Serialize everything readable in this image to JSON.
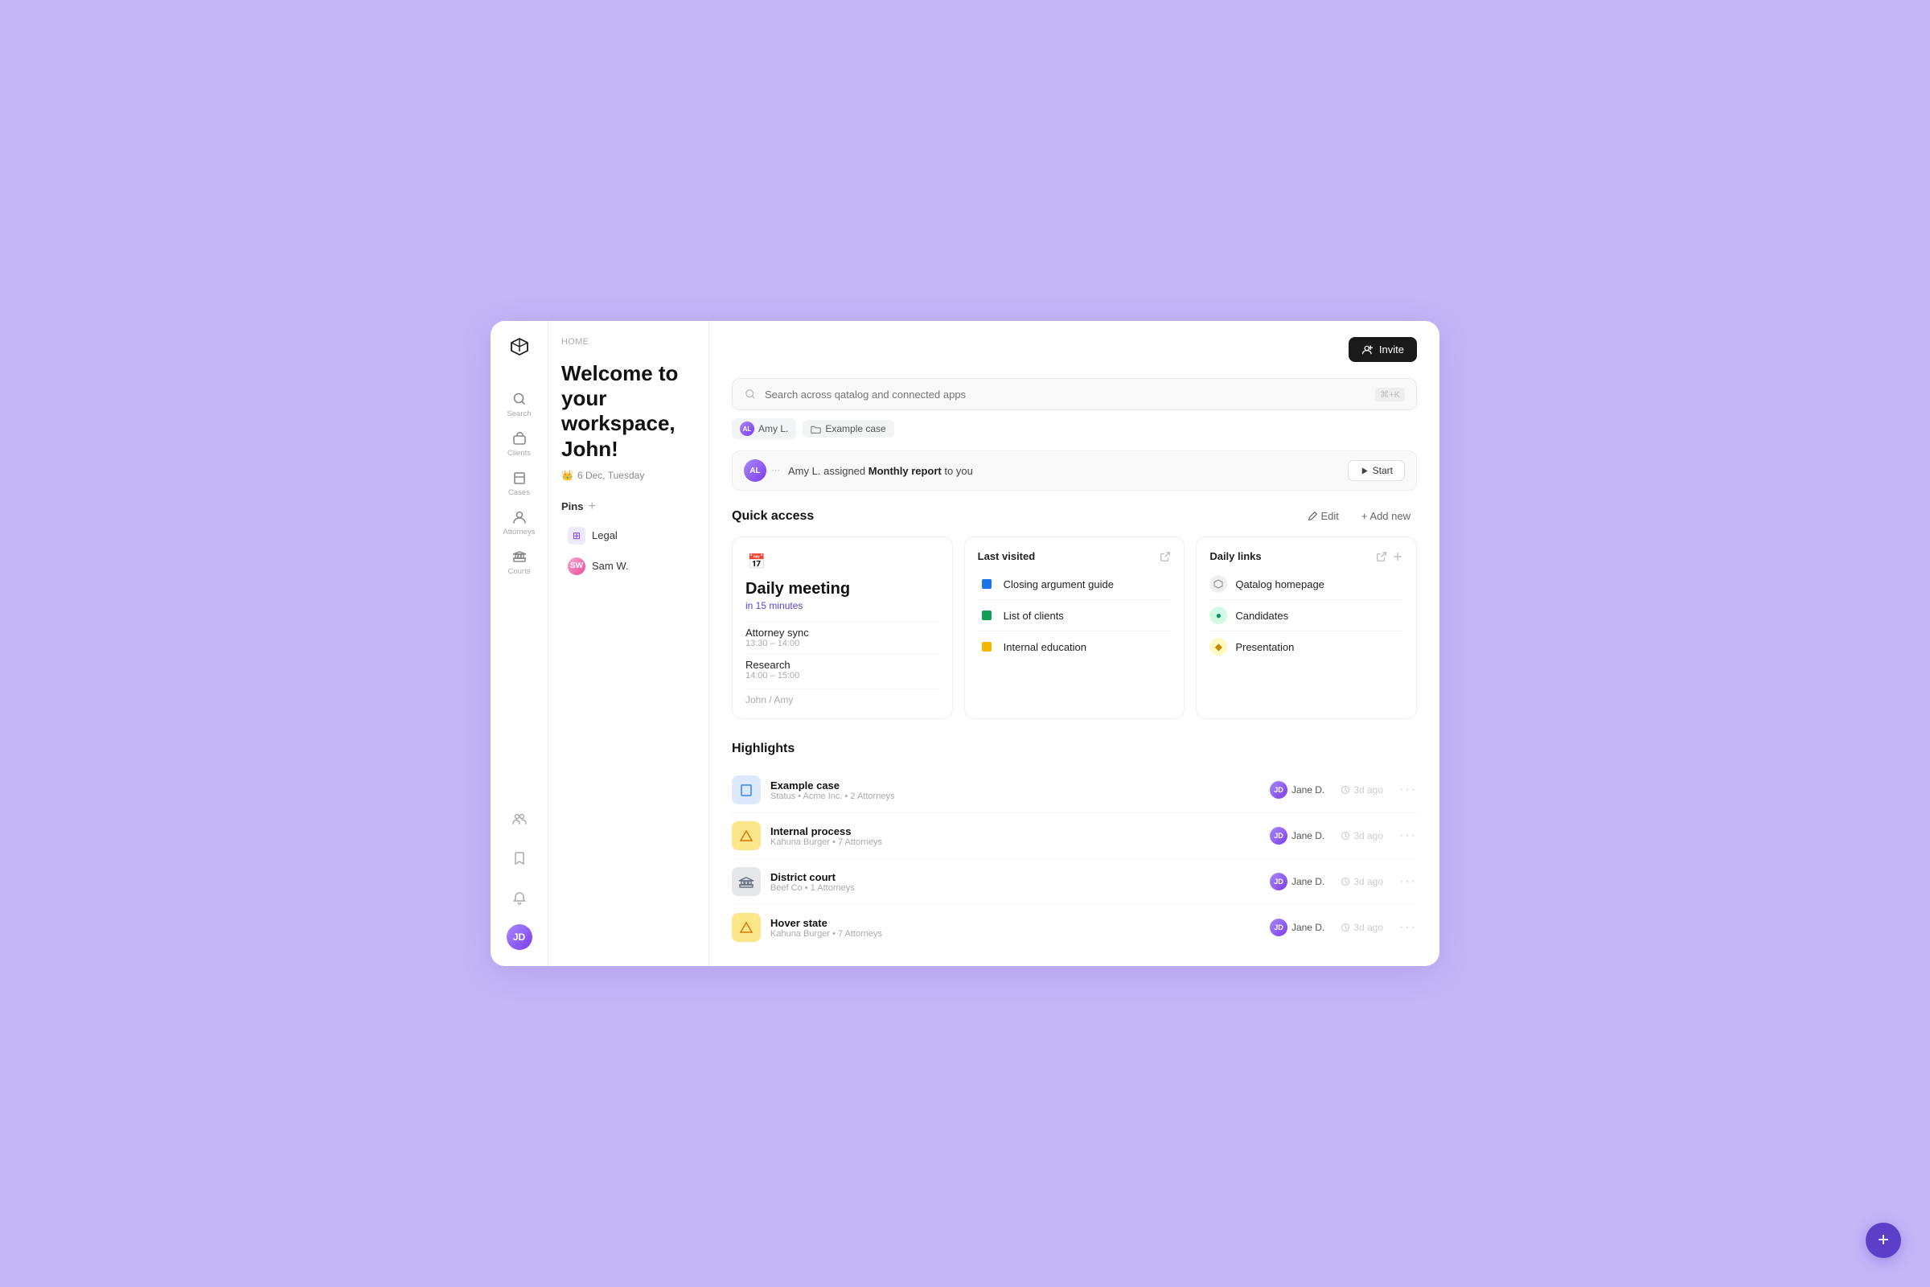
{
  "header": {
    "breadcrumb": "HOME",
    "invite_label": "Invite"
  },
  "welcome": {
    "title": "Welcome to your workspace, John!",
    "date": "6 Dec, Tuesday"
  },
  "sidebar": {
    "logo_alt": "Qatalog logo",
    "nav_items": [
      {
        "id": "search",
        "label": "Search",
        "icon": "search"
      },
      {
        "id": "clients",
        "label": "Clients",
        "icon": "briefcase"
      },
      {
        "id": "cases",
        "label": "Cases",
        "icon": "folder"
      },
      {
        "id": "attorneys",
        "label": "Attorneys",
        "icon": "person"
      },
      {
        "id": "courts",
        "label": "Courts",
        "icon": "building"
      }
    ],
    "bottom_icons": [
      {
        "id": "team",
        "icon": "team"
      },
      {
        "id": "bookmark",
        "icon": "bookmark"
      },
      {
        "id": "bell",
        "icon": "bell"
      }
    ],
    "avatar_initials": "JD"
  },
  "pins": {
    "header": "Pins",
    "add_label": "+",
    "items": [
      {
        "id": "legal",
        "label": "Legal",
        "type": "grid"
      },
      {
        "id": "samw",
        "label": "Sam W.",
        "type": "avatar",
        "initials": "SW"
      }
    ]
  },
  "search_bar": {
    "placeholder": "Search across qatalog and connected apps",
    "shortcut": "⌘+K"
  },
  "filter_pills": [
    {
      "id": "amy",
      "label": "Amy L.",
      "type": "avatar",
      "initials": "AL"
    },
    {
      "id": "example",
      "label": "Example case",
      "type": "folder"
    }
  ],
  "notification": {
    "avatar_initials": "AL",
    "text_pre": "Amy L.",
    "text_action": "assigned",
    "text_highlight": "Monthly report",
    "text_post": "to you",
    "start_label": "Start"
  },
  "quick_access": {
    "title": "Quick access",
    "edit_label": "Edit",
    "add_new_label": "+ Add new",
    "cards": {
      "meeting": {
        "icon": "📅",
        "title": "Daily meeting",
        "time_highlight": "in 15 minutes",
        "events": [
          {
            "name": "Attorney sync",
            "time": "13:30 – 14:00"
          },
          {
            "name": "Research",
            "time": "14:00 – 15:00"
          }
        ],
        "attendees": "John / Amy"
      },
      "last_visited": {
        "title": "Last visited",
        "items": [
          {
            "label": "Closing argument guide",
            "icon_color": "#1a73e8"
          },
          {
            "label": "List of clients",
            "icon_color": "#0f9d58"
          },
          {
            "label": "Internal education",
            "icon_color": "#f4b400"
          }
        ]
      },
      "daily_links": {
        "title": "Daily links",
        "items": [
          {
            "label": "Qatalog homepage",
            "icon_type": "circle_gray"
          },
          {
            "label": "Candidates",
            "icon_type": "circle_green"
          },
          {
            "label": "Presentation",
            "icon_type": "circle_yellow"
          }
        ]
      }
    }
  },
  "highlights": {
    "title": "Highlights",
    "rows": [
      {
        "name": "Example case",
        "meta": "Status • Acme Inc.  •  2 Attorneys",
        "icon_type": "case",
        "user": "Jane D.",
        "user_initials": "JD",
        "time": "3d ago"
      },
      {
        "name": "Internal process",
        "meta": "Kahuna Burger  •  7 Attorneys",
        "icon_type": "process",
        "user": "Jane D.",
        "user_initials": "JD",
        "time": "3d ago"
      },
      {
        "name": "District court",
        "meta": "Beef Co  •  1 Attorneys",
        "icon_type": "court",
        "user": "Jane D.",
        "user_initials": "JD",
        "time": "3d ago"
      },
      {
        "name": "Hover state",
        "meta": "Kahuna Burger  •  7 Attorneys",
        "icon_type": "hover",
        "user": "Jane D.",
        "user_initials": "JD",
        "time": "3d ago"
      }
    ]
  },
  "fab": {
    "label": "+"
  }
}
